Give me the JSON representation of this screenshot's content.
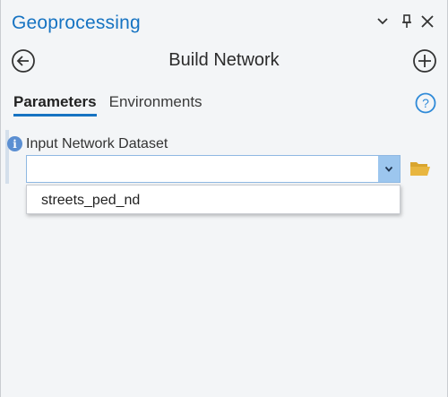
{
  "pane": {
    "title": "Geoprocessing"
  },
  "window_controls": {
    "menu_icon": "chevron-down-icon",
    "pin_icon": "pin-icon",
    "close_icon": "close-icon"
  },
  "tool": {
    "title": "Build Network",
    "back_icon": "back-arrow-icon",
    "add_icon": "add-circle-icon"
  },
  "tabs": [
    {
      "label": "Parameters",
      "active": true
    },
    {
      "label": "Environments",
      "active": false
    }
  ],
  "help_icon": "help-icon",
  "parameter": {
    "label": "Input Network Dataset",
    "value": "",
    "info_icon": "info-icon",
    "browse_icon": "folder-open-icon"
  },
  "dropdown": {
    "options": [
      "streets_ped_nd"
    ]
  },
  "colors": {
    "accent": "#1673c2",
    "arrow_button": "#9cc6ee",
    "info": "#5b8fd2",
    "folder": "#e8b640"
  }
}
